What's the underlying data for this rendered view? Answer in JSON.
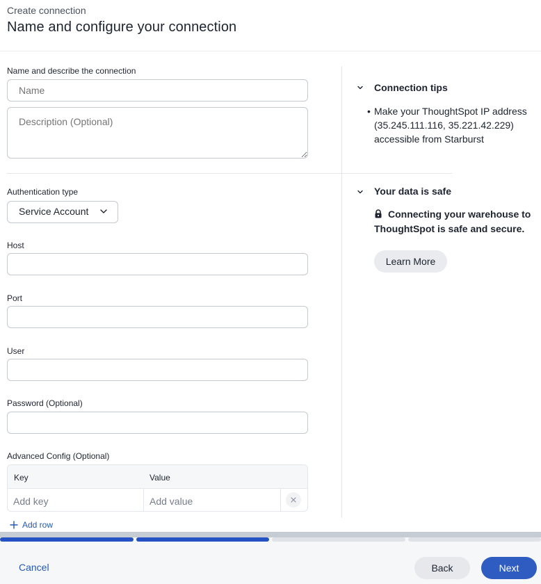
{
  "header": {
    "subtitle": "Create connection",
    "title": "Name and configure your connection"
  },
  "form": {
    "name_section_label": "Name and describe the connection",
    "name_placeholder": "Name",
    "description_placeholder": "Description (Optional)",
    "auth_label": "Authentication type",
    "auth_value": "Service Account",
    "host_label": "Host",
    "host_value": "",
    "port_label": "Port",
    "port_value": "",
    "user_label": "User",
    "user_value": "",
    "password_label": "Password (Optional)",
    "password_value": "",
    "advanced_label": "Advanced Config (Optional)",
    "table": {
      "key_header": "Key",
      "value_header": "Value",
      "key_placeholder": "Add key",
      "value_placeholder": "Add value"
    },
    "add_row": "Add row"
  },
  "side": {
    "tips_title": "Connection tips",
    "tip_bullet": "•",
    "tip_text": "Make your ThoughtSpot IP address (35.245.111.116, 35.221.42.229) accessible from Starburst",
    "safe_title": "Your data is safe",
    "safe_text": "Connecting your warehouse to ThoughtSpot is safe and secure.",
    "learn_more": "Learn More"
  },
  "progress": {
    "current_step": 2,
    "total_steps": 4
  },
  "footer": {
    "cancel": "Cancel",
    "back": "Back",
    "next": "Next"
  },
  "colors": {
    "accent": "#2f5cc1",
    "link": "#2359b6",
    "progress_active": "#2452c4",
    "progress_inactive": "#dfe3e8"
  },
  "icons": {
    "section_toggle": "chevron-down-icon",
    "dropdown": "chevron-down-icon",
    "lock": "lock-icon",
    "add": "plus-icon",
    "remove": "close-icon"
  }
}
